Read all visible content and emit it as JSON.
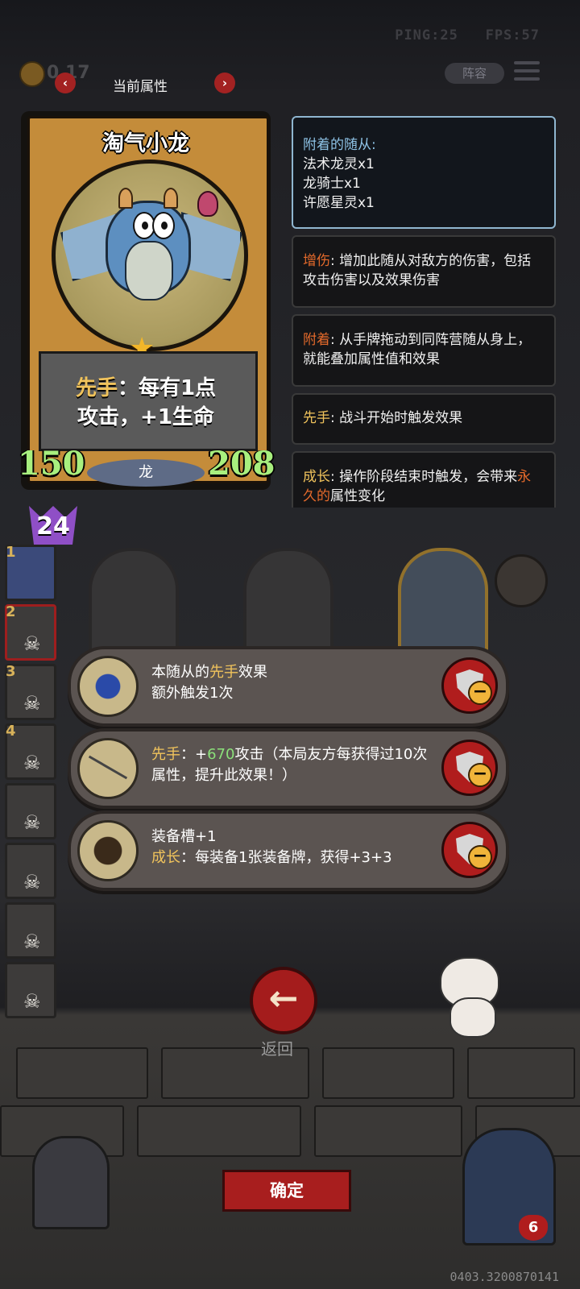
{
  "hud": {
    "ping": "PING:25",
    "fps": "FPS:57",
    "coins": "0 17",
    "lineup_label": "阵容"
  },
  "nav": {
    "title": "当前属性",
    "prev_icon": "chevron-left-icon",
    "next_icon": "chevron-right-icon"
  },
  "card": {
    "name": "淘气小龙",
    "desc_keyword": "先手",
    "desc_line1_rest": "：每有1点",
    "desc_line2": "攻击，+1生命",
    "attack": "150",
    "health": "208",
    "tribe": "龙",
    "level": "24"
  },
  "info_panels": {
    "attached_title": "附着的随从:",
    "attached_items": [
      "法术龙灵x1",
      "龙骑士x1",
      "许愿星灵x1"
    ],
    "damage_kw": "增伤",
    "damage_text": ": 增加此随从对敌方的伤害，包括攻击伤害以及效果伤害",
    "attach_kw": "附着",
    "attach_text": ": 从手牌拖动到同阵营随从身上，就能叠加属性值和效果",
    "first_kw": "先手",
    "first_text": ": 战斗开始时触发效果",
    "growth_kw": "成长",
    "growth_text_a": ": 操作阶段结束时触发，会带来",
    "growth_kw2": "永久的",
    "growth_text_b": "属性变化"
  },
  "side_cards": [
    "1",
    "2",
    "3",
    "4"
  ],
  "effects": [
    {
      "line1_pre": "本随从的",
      "line1_kw": "先手",
      "line1_post": "效果",
      "line2": "额外触发1次"
    },
    {
      "kw": "先手",
      "sep": "：+",
      "num": "670",
      "rest": "攻击（本局友方每获得过10次属性，提升此效果！）"
    },
    {
      "line1": "装备槽+1",
      "kw": "成长",
      "rest": "：每装备1张装备牌，获得+3+3"
    }
  ],
  "back_label": "返回",
  "confirm_label": "确定",
  "hand_count": "6",
  "build_id": "0403.3200870141"
}
